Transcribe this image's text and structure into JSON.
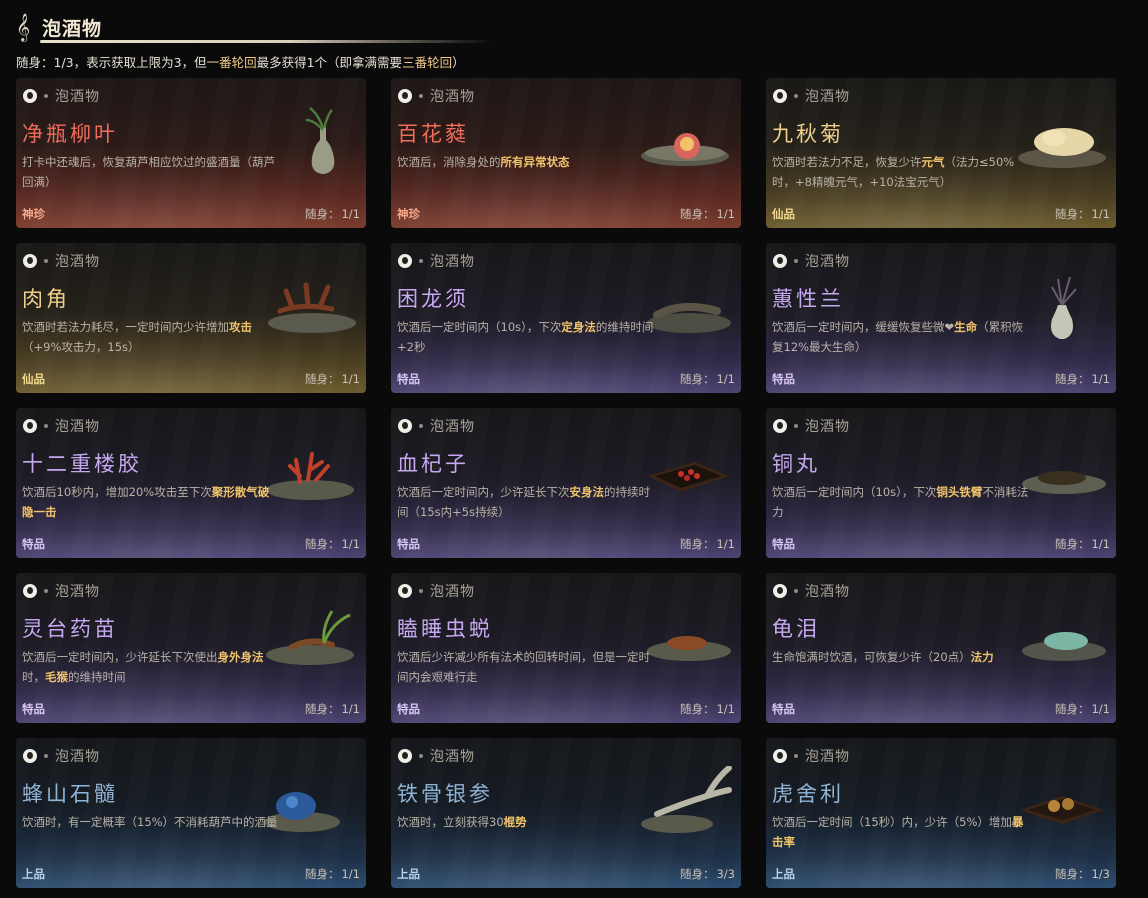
{
  "header": {
    "title": "泡酒物",
    "subtitle_parts": [
      "随身：1/3，表示获取上限为3，但",
      "一番轮回",
      "最多获得1个（即拿满需要",
      "三番轮回",
      "）"
    ]
  },
  "category_label": "泡酒物",
  "carry_label": "随身：",
  "cards": [
    {
      "name": "净瓶柳叶",
      "tier": "神珍",
      "tier_key": "shenzhen",
      "carry": "1/1",
      "art": "vase-willow-icon",
      "desc": [
        [
          "打卡中还魂后，恢复葫芦相应饮过的盛酒量（葫芦回满）",
          false
        ]
      ]
    },
    {
      "name": "百花蕤",
      "tier": "神珍",
      "tier_key": "shenzhen",
      "carry": "1/1",
      "art": "flower-dish-icon",
      "desc": [
        [
          "饮酒后，消除身处的",
          false
        ],
        [
          "所有异常状态",
          true
        ]
      ]
    },
    {
      "name": "九秋菊",
      "tier": "仙品",
      "tier_key": "xianpin",
      "carry": "1/1",
      "art": "chrysanthemum-dish-icon",
      "desc": [
        [
          "饮酒时若法力不足，恢复少许",
          false
        ],
        [
          "元气",
          true
        ],
        [
          "（法力≤50%时，+8精魄元气，+10法宝元气）",
          false
        ]
      ]
    },
    {
      "name": "肉角",
      "tier": "仙品",
      "tier_key": "xianpin",
      "carry": "1/1",
      "art": "antler-dish-icon",
      "desc": [
        [
          "饮酒时若法力耗尽，一定时间内少许增加",
          false
        ],
        [
          "攻击",
          true
        ],
        [
          "（+9%攻击力，15s）",
          false
        ]
      ]
    },
    {
      "name": "困龙须",
      "tier": "特品",
      "tier_key": "tepin",
      "carry": "1/1",
      "art": "dragon-whisker-dish-icon",
      "desc": [
        [
          "饮酒后一定时间内（10s），下次",
          false
        ],
        [
          "定身法",
          true
        ],
        [
          "的维持时间+2秒",
          false
        ]
      ]
    },
    {
      "name": "蕙性兰",
      "tier": "特品",
      "tier_key": "tepin",
      "carry": "1/1",
      "art": "orchid-vase-icon",
      "desc": [
        [
          "饮酒后一定时间内，缓缓恢复些微❤",
          false
        ],
        [
          "生命",
          true
        ],
        [
          "（累积恢复12%最大生命）",
          false
        ]
      ]
    },
    {
      "name": "十二重楼胶",
      "tier": "特品",
      "tier_key": "tepin",
      "carry": "1/1",
      "art": "coral-dish-icon",
      "desc": [
        [
          "饮酒后10秒内，增加20%攻击至下次",
          false
        ],
        [
          "聚形散气破隐一击",
          true
        ]
      ]
    },
    {
      "name": "血杞子",
      "tier": "特品",
      "tier_key": "tepin",
      "carry": "1/1",
      "art": "berry-tray-icon",
      "desc": [
        [
          "饮酒后一定时间内，少许延长下次",
          false
        ],
        [
          "安身法",
          true
        ],
        [
          "的持续时间（15s内+5s持续）",
          false
        ]
      ]
    },
    {
      "name": "铜丸",
      "tier": "特品",
      "tier_key": "tepin",
      "carry": "1/1",
      "art": "copper-pill-dish-icon",
      "desc": [
        [
          "饮酒后一定时间内（10s），下次",
          false
        ],
        [
          "铜头铁臂",
          true
        ],
        [
          "不消耗法力",
          false
        ]
      ]
    },
    {
      "name": "灵台药苗",
      "tier": "特品",
      "tier_key": "tepin",
      "carry": "1/1",
      "art": "herb-sprout-dish-icon",
      "desc": [
        [
          "饮酒后一定时间内，少许延长下次使出",
          false
        ],
        [
          "身外身法",
          true
        ],
        [
          "时，",
          false
        ],
        [
          "毛猴",
          true
        ],
        [
          "的维持时间",
          false
        ]
      ]
    },
    {
      "name": "瞌睡虫蜕",
      "tier": "特品",
      "tier_key": "tepin",
      "carry": "1/1",
      "art": "insect-shell-dish-icon",
      "desc": [
        [
          "饮酒后少许减少所有法术的回转时间，但是一定时间内会艰难行走",
          false
        ]
      ]
    },
    {
      "name": "龟泪",
      "tier": "特品",
      "tier_key": "tepin",
      "carry": "1/1",
      "art": "turtle-tear-dish-icon",
      "desc": [
        [
          "生命饱满时饮酒，可恢复少许（20点）",
          false
        ],
        [
          "法力",
          true
        ]
      ]
    },
    {
      "name": "蜂山石髓",
      "tier": "上品",
      "tier_key": "shangpin",
      "carry": "1/1",
      "art": "blue-stone-dish-icon",
      "desc": [
        [
          "饮酒时，有一定概率（15%）不消耗葫芦中的酒量",
          false
        ]
      ]
    },
    {
      "name": "铁骨银参",
      "tier": "上品",
      "tier_key": "shangpin",
      "carry": "3/3",
      "art": "ginseng-root-icon",
      "desc": [
        [
          "饮酒时，立刻获得30",
          false
        ],
        [
          "棍势",
          true
        ]
      ]
    },
    {
      "name": "虎舍利",
      "tier": "上品",
      "tier_key": "shangpin",
      "carry": "1/3",
      "art": "relic-tray-icon",
      "desc": [
        [
          "饮酒后一定时间（15秒）内，少许（5%）增加",
          false
        ],
        [
          "暴击率",
          true
        ]
      ]
    }
  ]
}
